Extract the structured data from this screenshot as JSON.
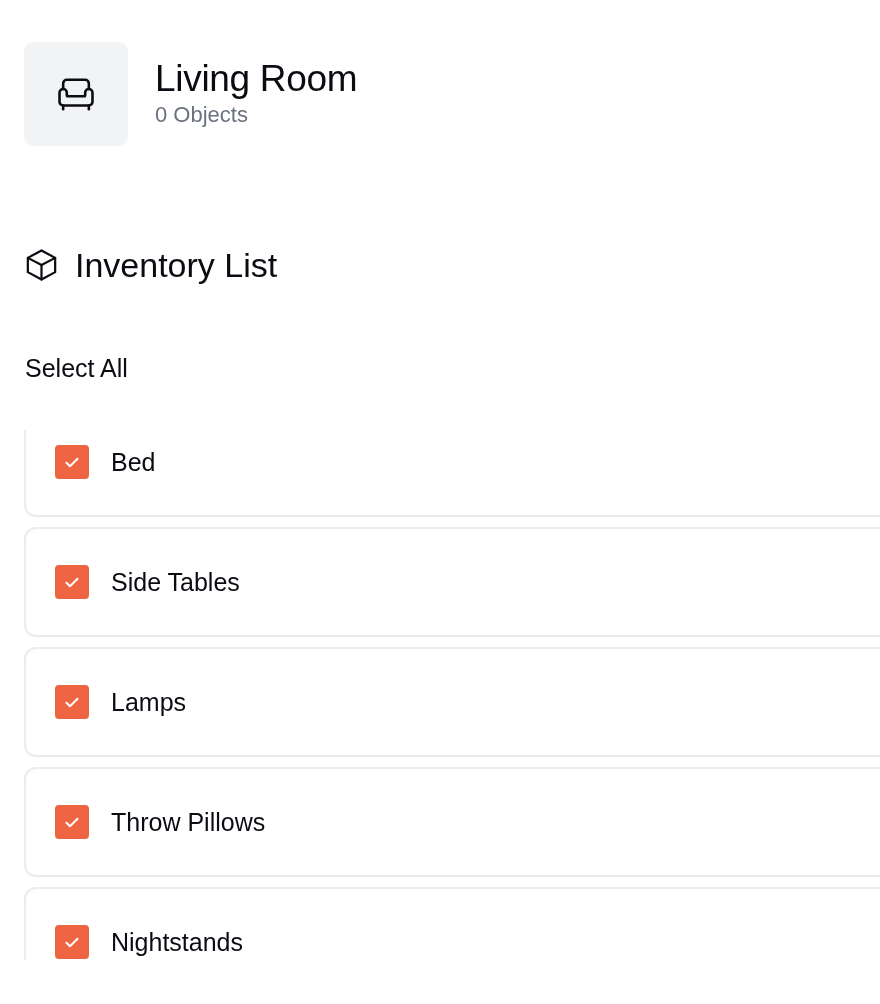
{
  "room": {
    "title": "Living Room",
    "subtitle": "0 Objects"
  },
  "inventory": {
    "title": "Inventory List",
    "select_all": "Select All",
    "items": [
      {
        "label": "Bed",
        "checked": true
      },
      {
        "label": "Side Tables",
        "checked": true
      },
      {
        "label": "Lamps",
        "checked": true
      },
      {
        "label": "Throw Pillows",
        "checked": true
      },
      {
        "label": "Nightstands",
        "checked": true
      }
    ]
  }
}
